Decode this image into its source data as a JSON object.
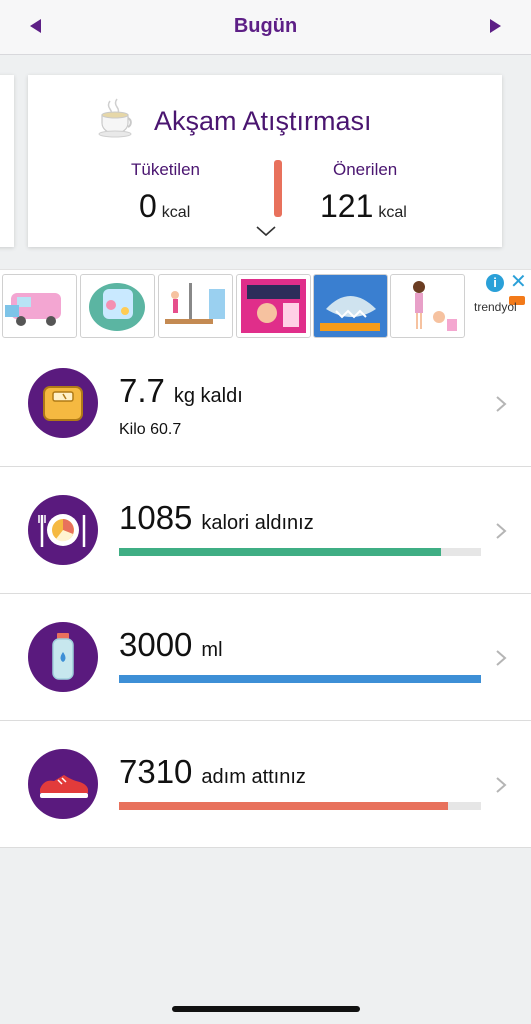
{
  "header": {
    "title": "Bugün",
    "prev_icon": "triangle-left-icon",
    "next_icon": "triangle-right-icon"
  },
  "meal": {
    "title": "Akşam Atıştırması",
    "icon": "tea-cup-icon",
    "consumed_label": "Tüketilen",
    "consumed_value": "0",
    "consumed_unit": "kcal",
    "recommended_label": "Önerilen",
    "recommended_value": "121",
    "recommended_unit": "kcal"
  },
  "ad": {
    "brand": "trendyol",
    "info_icon": "info-icon",
    "close_icon": "close-icon",
    "thumbnail_count": 6
  },
  "stats": {
    "weight": {
      "value": "7.7",
      "unit": "kg kaldı",
      "sub": "Kilo 60.7",
      "icon": "scale-icon"
    },
    "calories": {
      "value": "1085",
      "unit": "kalori aldınız",
      "progress": 0.89,
      "color": "#3fae84",
      "icon": "plate-icon"
    },
    "water": {
      "value": "3000",
      "unit": "ml",
      "progress": 1.0,
      "color": "#3d8fd6",
      "icon": "water-bottle-icon"
    },
    "steps": {
      "value": "7310",
      "unit": "adım attınız",
      "progress": 0.91,
      "color": "#e8715c",
      "icon": "sneaker-icon"
    }
  },
  "colors": {
    "brand": "#5d1f86",
    "accent": "#e8715c"
  }
}
